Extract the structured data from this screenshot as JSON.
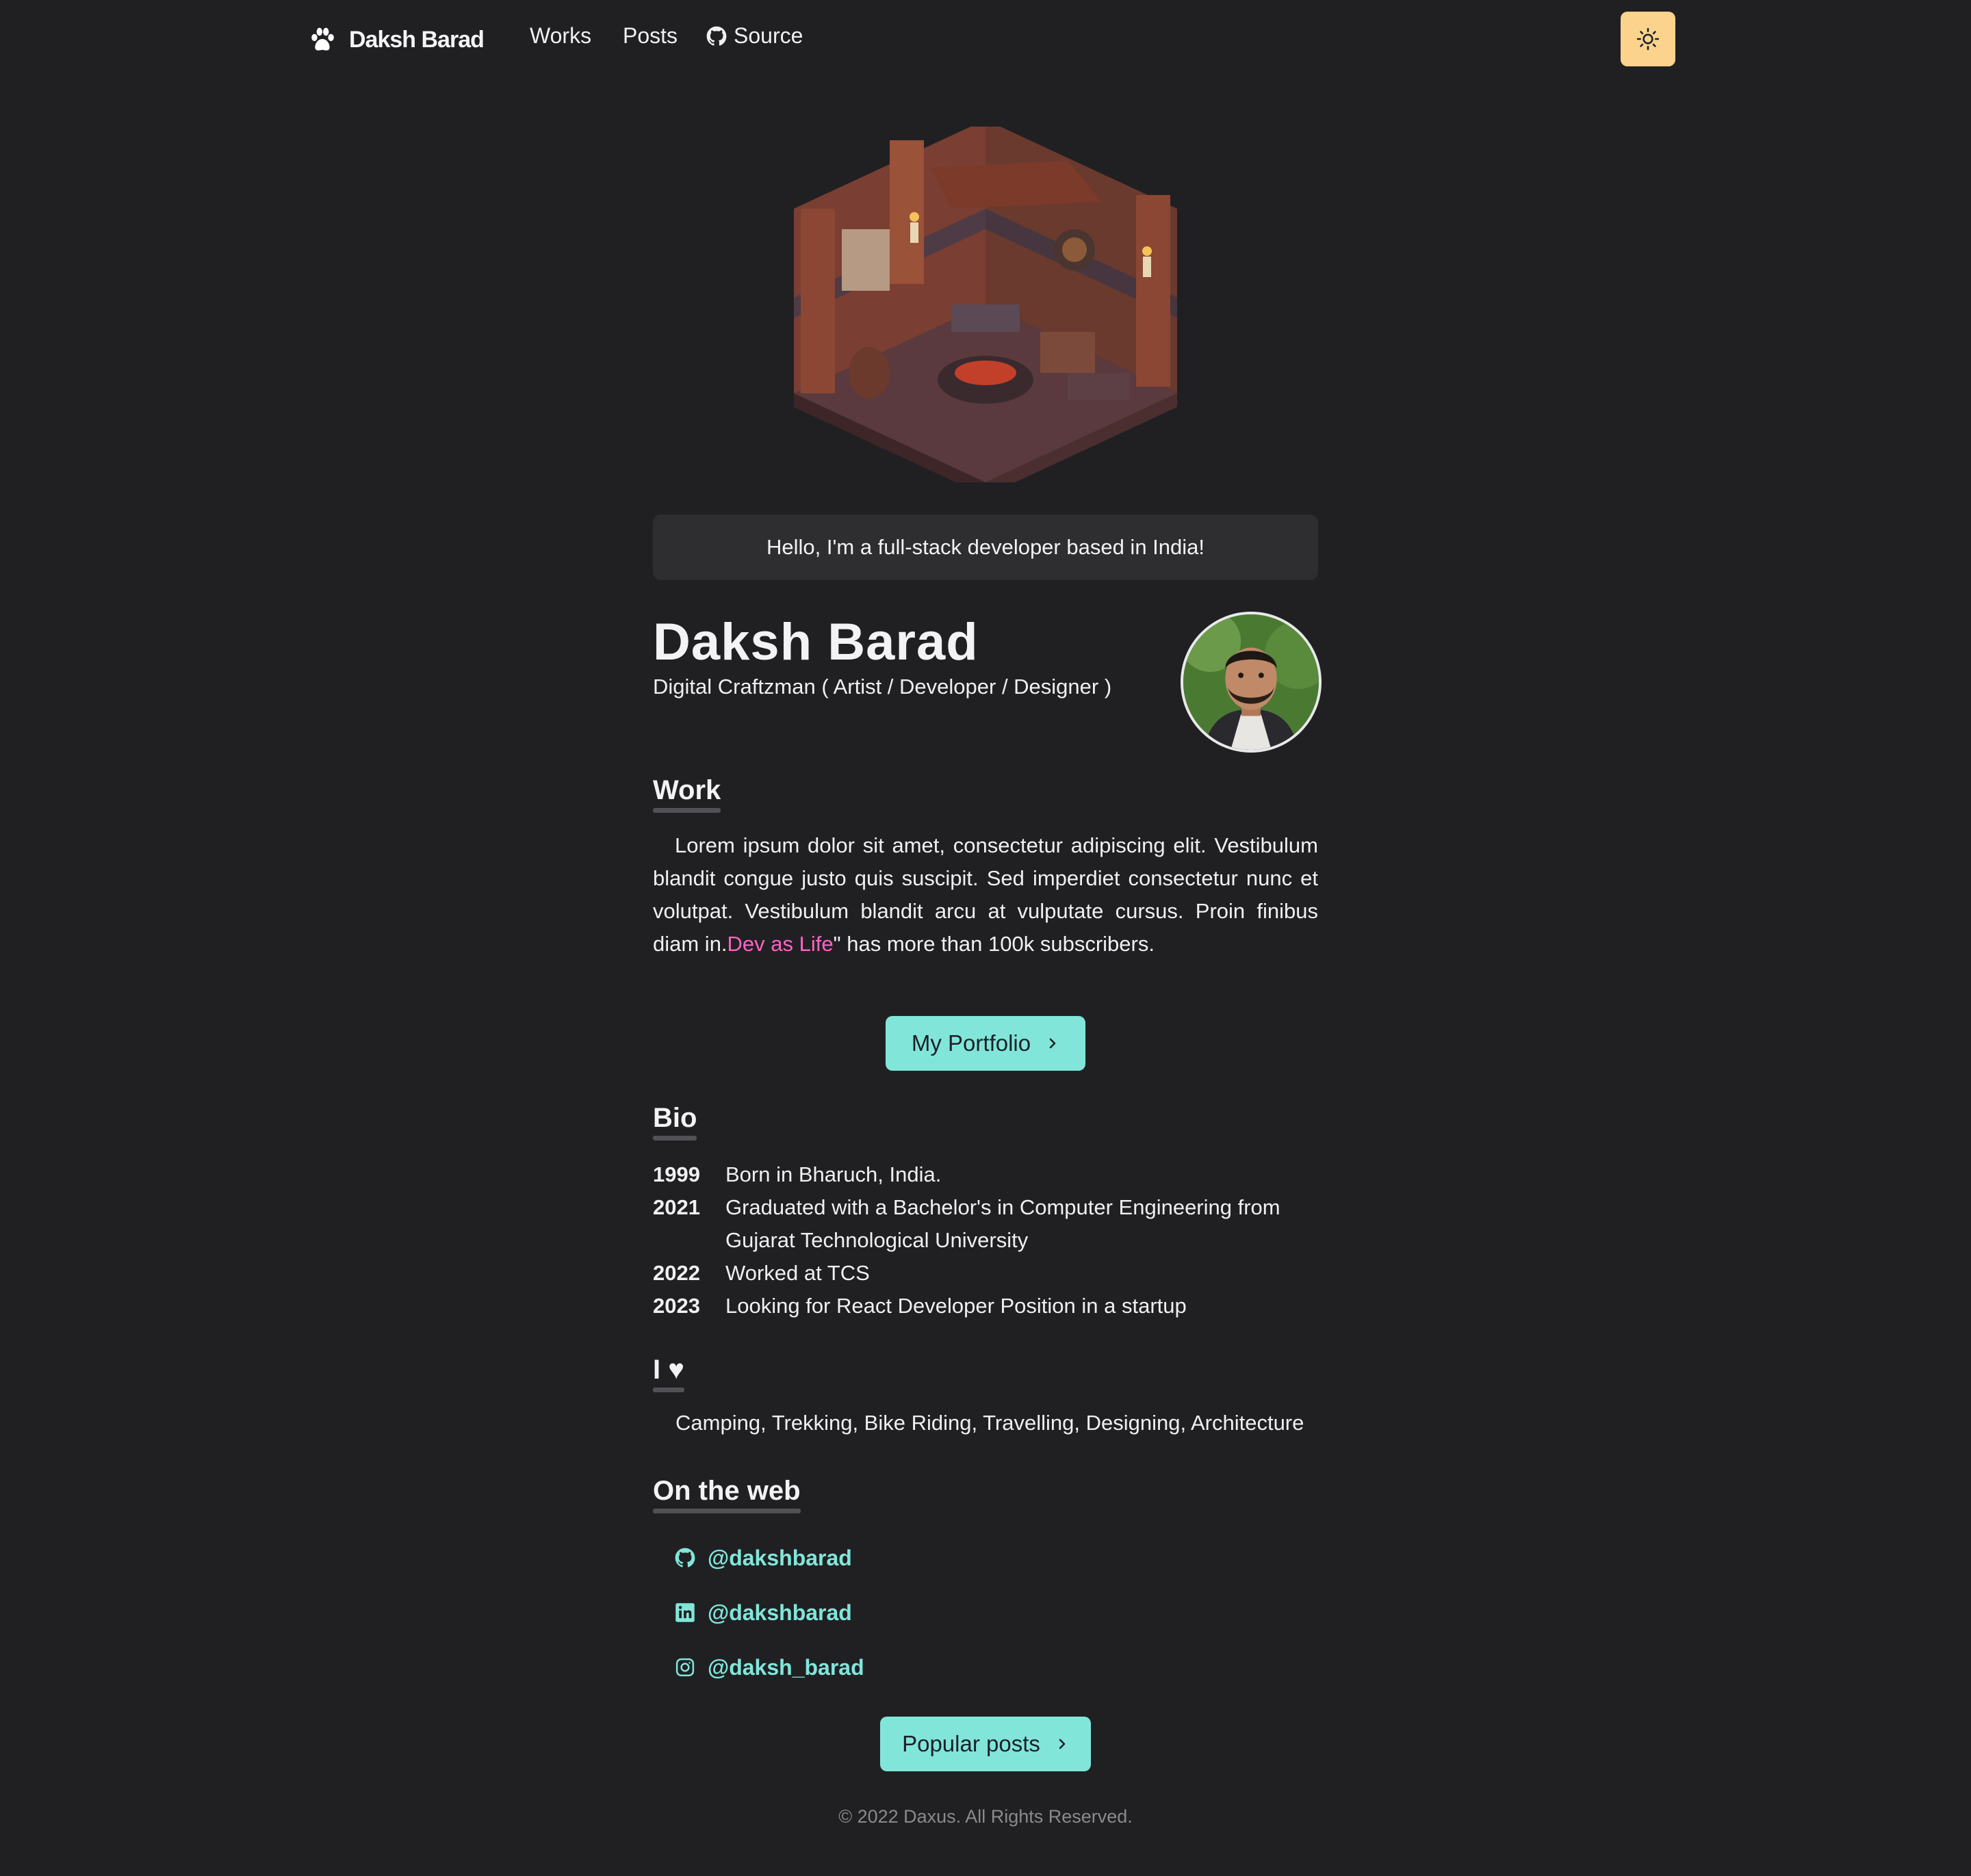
{
  "nav": {
    "logo_text": "Daksh Barad",
    "links": [
      {
        "label": "Works"
      },
      {
        "label": "Posts"
      },
      {
        "label": "Source",
        "icon": "github-icon"
      }
    ],
    "theme_icon": "sun-icon"
  },
  "greeting": "Hello, I'm a full-stack developer based in India!",
  "profile": {
    "name": "Daksh Barad",
    "role": "Digital Craftzman ( Artist / Developer / Designer )"
  },
  "work": {
    "title": "Work",
    "text_before": "Lorem ipsum dolor sit amet, consectetur adipiscing elit. Vestibulum blandit congue justo quis suscipit. Sed imperdiet consectetur nunc et volutpat. Vestibulum blandit arcu at vulputate cursus. Proin finibus diam in.",
    "link_text": "Dev as Life",
    "text_after": "\" has more than 100k subscribers.",
    "button_label": "My Portfolio"
  },
  "bio": {
    "title": "Bio",
    "entries": [
      {
        "year": "1999",
        "text": "Born in Bharuch, India."
      },
      {
        "year": "2021",
        "text": "Graduated with a Bachelor's in Computer Engineering from Gujarat Technological University"
      },
      {
        "year": "2022",
        "text": "Worked at TCS"
      },
      {
        "year": "2023",
        "text": "Looking for React Developer Position in a startup"
      }
    ]
  },
  "love": {
    "title": "I ♥",
    "text": "Camping, Trekking, Bike Riding, Travelling, Designing, Architecture"
  },
  "web": {
    "title": "On the web",
    "links": [
      {
        "icon": "github-icon",
        "label": "@dakshbarad"
      },
      {
        "icon": "linkedin-icon",
        "label": "@dakshbarad"
      },
      {
        "icon": "instagram-icon",
        "label": "@daksh_barad"
      }
    ]
  },
  "posts_button": "Popular posts",
  "footer": "© 2022 Daxus. All Rights Reserved.",
  "colors": {
    "background": "#202023",
    "accent": "#81e6d9",
    "link_pink": "#ff63c3",
    "theme_button": "#fbd38d"
  }
}
